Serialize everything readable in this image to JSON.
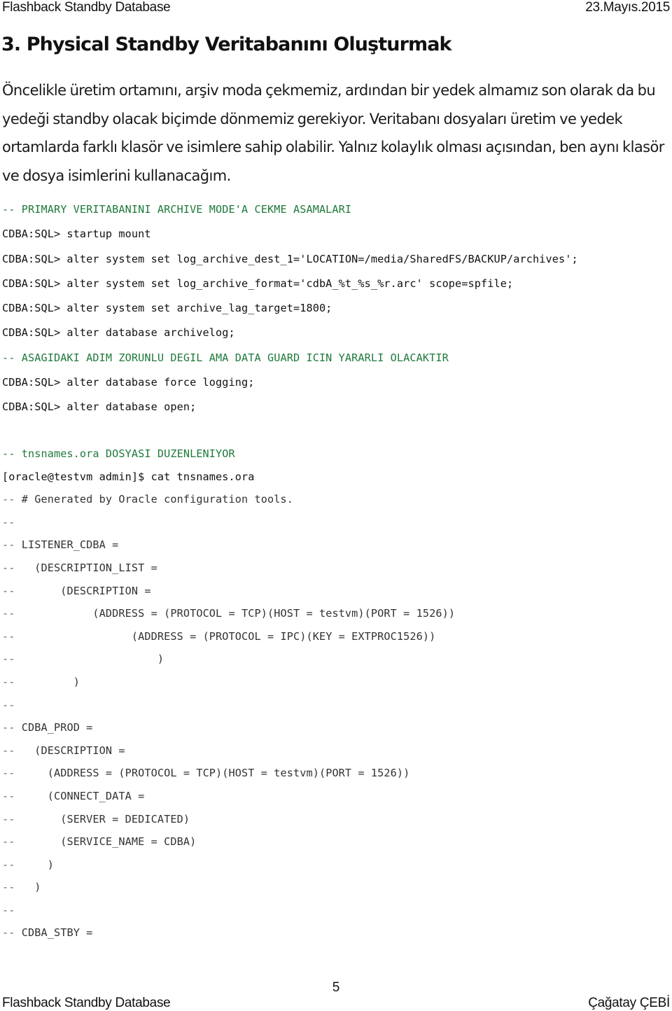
{
  "header": {
    "doc_title": "Flashback Standby Database",
    "date": "23.Mayıs.2015"
  },
  "section": {
    "title": "3. Physical Standby Veritabanını Oluşturmak",
    "intro": "Öncelikle üretim ortamını, arşiv moda çekmemiz, ardından bir yedek almamız son olarak da bu yedeği standby olacak biçimde dönmemiz gerekiyor. Veritabanı dosyaları üretim ve yedek ortamlarda farklı klasör ve isimlere sahip olabilir. Yalnız kolaylık olması açısından, ben aynı klasör ve dosya isimlerini kullanacağım."
  },
  "code_block_1": [
    {
      "type": "comment",
      "text": "-- PRIMARY VERITABANINI ARCHIVE MODE'A CEKME ASAMALARI"
    },
    {
      "type": "cmd",
      "text": "CDBA:SQL> startup mount"
    },
    {
      "type": "cmd",
      "text": "CDBA:SQL> alter system set log_archive_dest_1='LOCATION=/media/SharedFS/BACKUP/archives';"
    },
    {
      "type": "cmd",
      "text": "CDBA:SQL> alter system set log_archive_format='cdbA_%t_%s_%r.arc' scope=spfile;"
    },
    {
      "type": "cmd",
      "text": "CDBA:SQL> alter system set archive_lag_target=1800;"
    },
    {
      "type": "cmd",
      "text": "CDBA:SQL> alter database archivelog;"
    },
    {
      "type": "comment",
      "text": "-- ASAGIDAKI ADIM ZORUNLU DEGIL AMA DATA GUARD ICIN YARARLI OLACAKTIR"
    },
    {
      "type": "cmd",
      "text": "CDBA:SQL> alter database force logging;"
    },
    {
      "type": "cmd",
      "text": "CDBA:SQL> alter database open;"
    }
  ],
  "code_block_2": [
    {
      "type": "comment",
      "text": "-- tnsnames.ora DOSYASI DUZENLENIYOR"
    },
    {
      "type": "cmd",
      "text": "[oracle@testvm admin]$ cat tnsnames.ora"
    },
    {
      "type": "tns",
      "dash": "--",
      "text": " # Generated by Oracle configuration tools."
    },
    {
      "type": "tns",
      "dash": "--",
      "text": ""
    },
    {
      "type": "tns",
      "dash": "--",
      "text": " LISTENER_CDBA ="
    },
    {
      "type": "tns",
      "dash": "--",
      "text": "   (DESCRIPTION_LIST ="
    },
    {
      "type": "tns",
      "dash": "--",
      "text": "       (DESCRIPTION ="
    },
    {
      "type": "tns",
      "dash": "--",
      "text": "            (ADDRESS = (PROTOCOL = TCP)(HOST = testvm)(PORT = 1526))"
    },
    {
      "type": "tns",
      "dash": "--",
      "text": "                  (ADDRESS = (PROTOCOL = IPC)(KEY = EXTPROC1526))"
    },
    {
      "type": "tns",
      "dash": "--",
      "text": "                      )"
    },
    {
      "type": "tns",
      "dash": "--",
      "text": "         )"
    },
    {
      "type": "tns",
      "dash": "--",
      "text": ""
    },
    {
      "type": "tns",
      "dash": "--",
      "text": " CDBA_PROD ="
    },
    {
      "type": "tns",
      "dash": "--",
      "text": "   (DESCRIPTION ="
    },
    {
      "type": "tns",
      "dash": "--",
      "text": "     (ADDRESS = (PROTOCOL = TCP)(HOST = testvm)(PORT = 1526))"
    },
    {
      "type": "tns",
      "dash": "--",
      "text": "     (CONNECT_DATA ="
    },
    {
      "type": "tns",
      "dash": "--",
      "text": "       (SERVER = DEDICATED)"
    },
    {
      "type": "tns",
      "dash": "--",
      "text": "       (SERVICE_NAME = CDBA)"
    },
    {
      "type": "tns",
      "dash": "--",
      "text": "     )"
    },
    {
      "type": "tns",
      "dash": "--",
      "text": "   )"
    },
    {
      "type": "tns",
      "dash": "--",
      "text": ""
    },
    {
      "type": "tns",
      "dash": "--",
      "text": " CDBA_STBY ="
    }
  ],
  "footer": {
    "page_number": "5",
    "doc_title": "Flashback Standby Database",
    "author": "Çağatay ÇEBİ"
  },
  "colors": {
    "comment": "#1f7a3c",
    "code": "#111111",
    "tns_text": "#333333"
  }
}
